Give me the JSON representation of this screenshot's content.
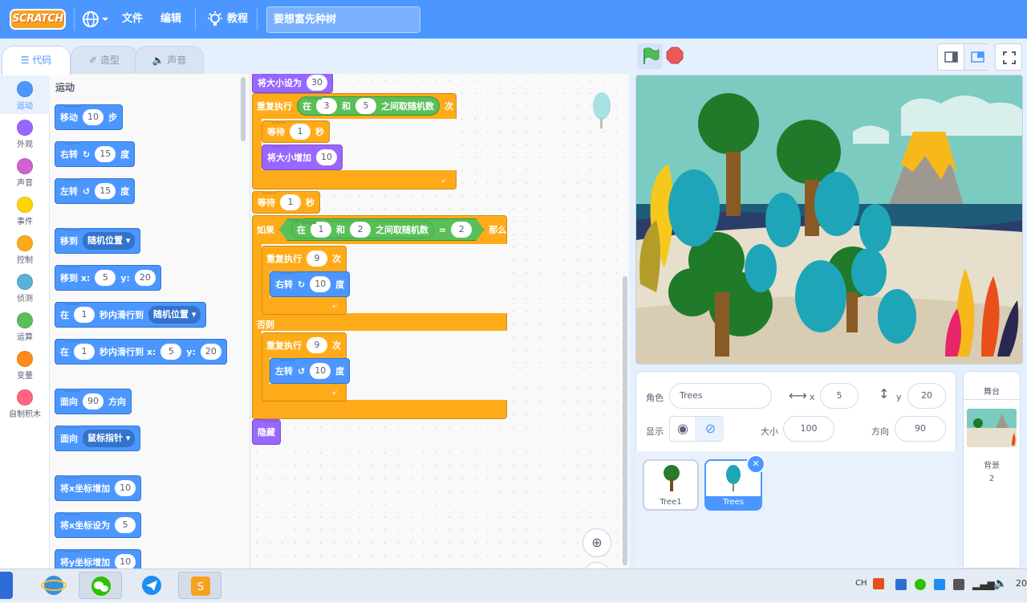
{
  "menubar": {
    "logo": "SCRATCH",
    "file": "文件",
    "edit": "编辑",
    "tutorials": "教程",
    "project_title": "要想富先种树"
  },
  "tabs": {
    "code": "代码",
    "costumes": "造型",
    "sounds": "声音"
  },
  "categories": [
    {
      "label": "运动",
      "color": "#4c97ff"
    },
    {
      "label": "外观",
      "color": "#9966ff"
    },
    {
      "label": "声音",
      "color": "#cf63cf"
    },
    {
      "label": "事件",
      "color": "#ffd500"
    },
    {
      "label": "控制",
      "color": "#ffab19"
    },
    {
      "label": "侦测",
      "color": "#5cb1d6"
    },
    {
      "label": "运算",
      "color": "#59c059"
    },
    {
      "label": "变量",
      "color": "#ff8c1a"
    },
    {
      "label": "自制积木",
      "color": "#ff6680"
    }
  ],
  "palette": {
    "heading": "运动",
    "move": {
      "label": "移动",
      "value": "10",
      "unit": "步"
    },
    "turn_right": {
      "label": "右转",
      "value": "15",
      "unit": "度"
    },
    "turn_left": {
      "label": "左转",
      "value": "15",
      "unit": "度"
    },
    "goto": {
      "label": "移到",
      "option": "随机位置"
    },
    "goto_xy": {
      "label": "移到 x:",
      "x": "5",
      "ylabel": "y:",
      "y": "20"
    },
    "glide": {
      "prefix": "在",
      "secs": "1",
      "label": "秒内滑行到",
      "option": "随机位置"
    },
    "glide_xy": {
      "prefix": "在",
      "secs": "1",
      "label": "秒内滑行到 x:",
      "x": "5",
      "ylabel": "y:",
      "y": "20"
    },
    "point_dir": {
      "label": "面向",
      "value": "90",
      "unit": "方向"
    },
    "point_towards": {
      "label": "面向",
      "option": "鼠标指针"
    },
    "change_x": {
      "label": "将x坐标增加",
      "value": "10"
    },
    "set_x": {
      "label": "将x坐标设为",
      "value": "5"
    },
    "change_y": {
      "label": "将y坐标增加",
      "value": "10"
    }
  },
  "script": {
    "set_size": {
      "label": "将大小设为",
      "value": "30"
    },
    "repeat1": {
      "label": "重复执行",
      "in": "在",
      "a": "3",
      "and": "和",
      "b": "5",
      "between": "之间取随机数",
      "times": "次"
    },
    "wait1": {
      "label": "等待",
      "value": "1",
      "unit": "秒"
    },
    "change_size": {
      "label": "将大小增加",
      "value": "10"
    },
    "wait2": {
      "label": "等待",
      "value": "1",
      "unit": "秒"
    },
    "if": {
      "label": "如果",
      "in": "在",
      "a": "1",
      "and": "和",
      "b": "2",
      "between": "之间取随机数",
      "eq": "=",
      "rhs": "2",
      "then": "那么"
    },
    "repeat2": {
      "label": "重复执行",
      "value": "9",
      "times": "次"
    },
    "turn_right": {
      "label": "右转",
      "value": "10",
      "unit": "度"
    },
    "else": "否则",
    "repeat3": {
      "label": "重复执行",
      "value": "9",
      "times": "次"
    },
    "turn_left": {
      "label": "左转",
      "value": "10",
      "unit": "度"
    },
    "hide": "隐藏"
  },
  "sprite_info": {
    "sprite_label": "角色",
    "sprite_name": "Trees",
    "x_label": "x",
    "x": "5",
    "y_label": "y",
    "y": "20",
    "show_label": "显示",
    "size_label": "大小",
    "size": "100",
    "direction_label": "方向",
    "direction": "90"
  },
  "sprites": [
    {
      "name": "Tree1",
      "selected": false
    },
    {
      "name": "Trees",
      "selected": true
    }
  ],
  "stage_panel": {
    "title": "舞台",
    "backdrops_label": "背景",
    "backdrops_count": "2"
  },
  "taskbar": {
    "ime": "CH",
    "clock": "20"
  }
}
